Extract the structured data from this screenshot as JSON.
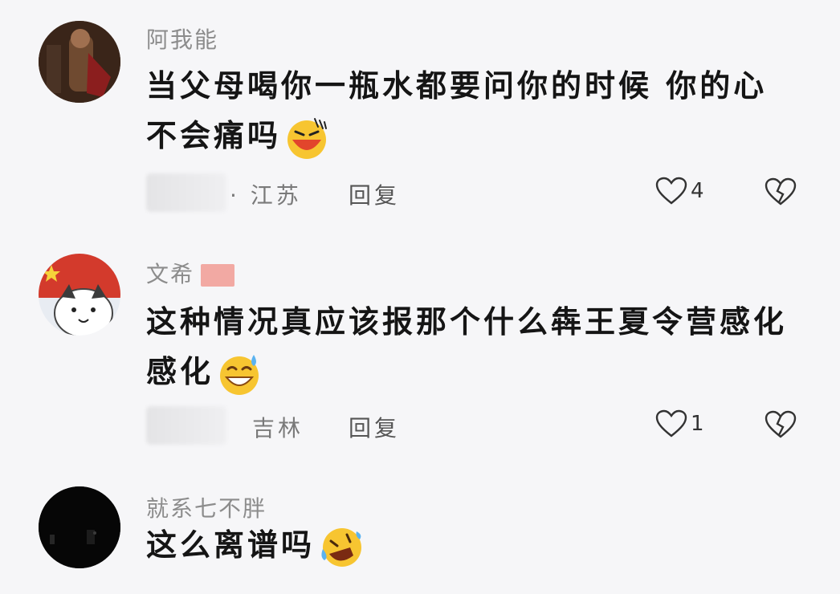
{
  "comments": [
    {
      "username": "阿我能",
      "text": "当父母喝你一瓶水都要问你的时候 你的心不会痛吗",
      "emoji": "laughing-tears-emoji",
      "location": "· 江苏",
      "reply_label": "回复",
      "likes": "4"
    },
    {
      "username": "文希",
      "text": "这种情况真应该报那个什么犇王夏令营感化感化",
      "emoji": "grinning-sweat-emoji",
      "location": "吉林",
      "reply_label": "回复",
      "likes": "1"
    },
    {
      "username": "就系七不胖",
      "text": "这么离谱吗",
      "emoji": "rolling-laughing-emoji"
    }
  ],
  "icons": {
    "like": "heart-outline-icon",
    "dislike": "broken-heart-icon"
  },
  "colors": {
    "background": "#f6f6f8",
    "username": "#8c8c8c",
    "text": "#151515",
    "emoji_yellow": "#f7c531",
    "emoji_mouth": "#e2452c"
  }
}
